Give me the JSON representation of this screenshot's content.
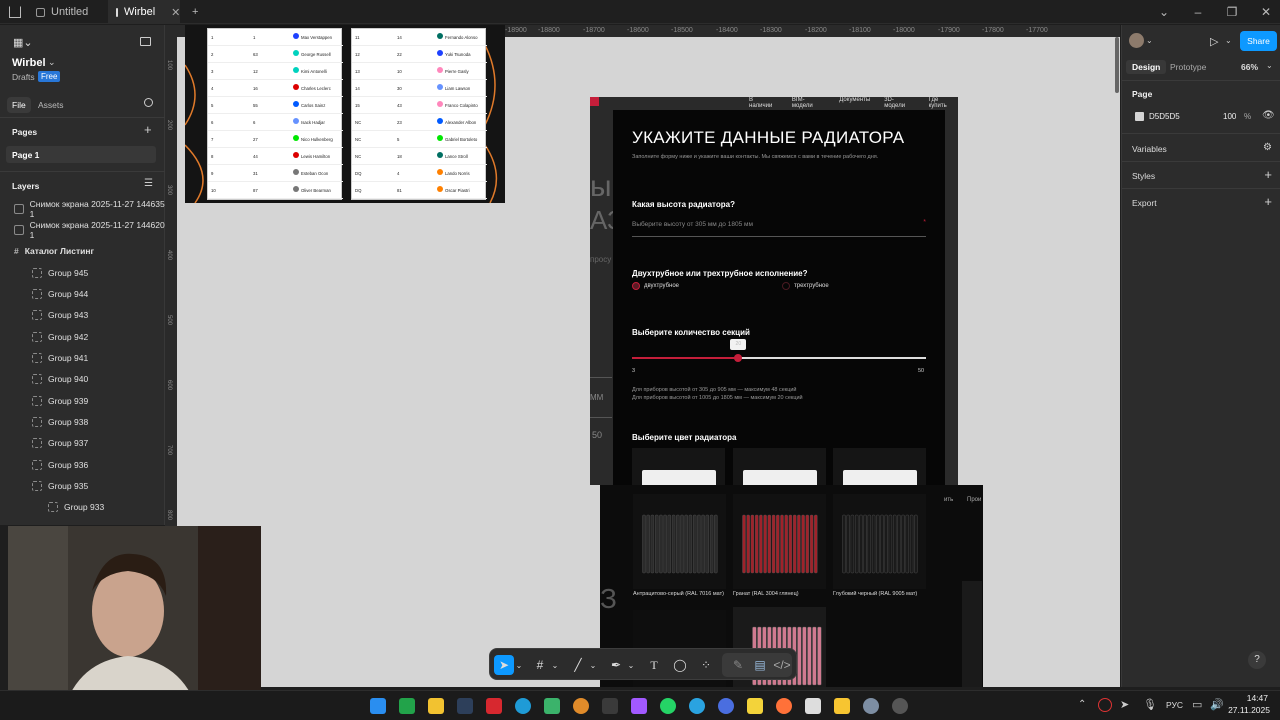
{
  "titlebar": {
    "tabs": [
      {
        "label": "Untitled"
      },
      {
        "label": "Wirbel"
      }
    ]
  },
  "file": {
    "name": "Wirbel",
    "location": "Drafts",
    "plan": "Free",
    "tab_file": "File",
    "tab_assets": "Assets"
  },
  "pages": {
    "title": "Pages",
    "items": [
      "Page 1"
    ]
  },
  "layers": {
    "title": "Layers",
    "items": [
      "Снимок экрана 2025-11-27 144635 1",
      "Снимок экрана 2025-11-27 144620 1",
      "Каталог Листинг",
      "Group 945",
      "Group 944",
      "Group 943",
      "Group 942",
      "Group 941",
      "Group 940",
      "Group 939",
      "Group 938",
      "Group 937",
      "Group 936",
      "Group 935",
      "Group 933"
    ]
  },
  "ruler": {
    "top": [
      "-18900",
      "-18800",
      "-18700",
      "-18600",
      "-18500",
      "-18400",
      "-18300",
      "-18200",
      "-18100",
      "-18000",
      "-17900",
      "-17800",
      "-17700"
    ],
    "left": [
      "100",
      "200",
      "300",
      "400",
      "500",
      "600",
      "700",
      "800",
      "900",
      "1000"
    ]
  },
  "right": {
    "tab_design": "Design",
    "tab_prototype": "Prototype",
    "zoom": "66%",
    "share": "Share",
    "page_label": "Page",
    "page_color": "D5D5D5",
    "page_opacity": "100",
    "percent": "%",
    "variables": "Variables",
    "styles": "Styles",
    "export": "Export",
    "colors": {
      "accent": "#0d99ff",
      "canvas": "#D5D5D5"
    }
  },
  "race_table": {
    "left": [
      {
        "pos": "1",
        "num": "1",
        "driver": "Max Verstappen",
        "color": "#1e41ff"
      },
      {
        "pos": "2",
        "num": "63",
        "driver": "George Russell",
        "color": "#00d2be"
      },
      {
        "pos": "3",
        "num": "12",
        "driver": "Kimi Antonelli",
        "color": "#00d2be"
      },
      {
        "pos": "4",
        "num": "16",
        "driver": "Charles Leclerc",
        "color": "#dc0000"
      },
      {
        "pos": "5",
        "num": "55",
        "driver": "Carlos Sainz",
        "color": "#005aff"
      },
      {
        "pos": "6",
        "num": "6",
        "driver": "Isack Hadjar",
        "color": "#6692ff"
      },
      {
        "pos": "7",
        "num": "27",
        "driver": "Nico Hulkenberg",
        "color": "#00e701"
      },
      {
        "pos": "8",
        "num": "44",
        "driver": "Lewis Hamilton",
        "color": "#dc0000"
      },
      {
        "pos": "9",
        "num": "31",
        "driver": "Esteban Ocon",
        "color": "#777777"
      },
      {
        "pos": "10",
        "num": "87",
        "driver": "Oliver Bearman",
        "color": "#777777"
      }
    ],
    "right": [
      {
        "pos": "11",
        "num": "14",
        "driver": "Fernando Alonso",
        "color": "#006f62"
      },
      {
        "pos": "12",
        "num": "22",
        "driver": "Yuki Tsunoda",
        "color": "#1e41ff"
      },
      {
        "pos": "13",
        "num": "10",
        "driver": "Pierre Gasly",
        "color": "#ff87bc"
      },
      {
        "pos": "14",
        "num": "30",
        "driver": "Liam Lawson",
        "color": "#6692ff"
      },
      {
        "pos": "15",
        "num": "43",
        "driver": "Franco Colapinto",
        "color": "#ff87bc"
      },
      {
        "pos": "NC",
        "num": "23",
        "driver": "Alexander Albon",
        "color": "#005aff"
      },
      {
        "pos": "NC",
        "num": "5",
        "driver": "Gabriel Bortoleto",
        "color": "#00e701"
      },
      {
        "pos": "NC",
        "num": "18",
        "driver": "Lance Stroll",
        "color": "#006f62"
      },
      {
        "pos": "DQ",
        "num": "4",
        "driver": "Lando Norris",
        "color": "#ff8000"
      },
      {
        "pos": "DQ",
        "num": "81",
        "driver": "Oscar Piastri",
        "color": "#ff8000"
      }
    ]
  },
  "form": {
    "nav": [
      "В наличии",
      "BIM-модели",
      "Документы",
      "3D-модели",
      "Где купить"
    ],
    "title": "УКАЖИТЕ ДАННЫЕ РАДИАТОРА",
    "subtitle": "Заполните форму ниже и укажите ваши контакты. Мы свяжемся с вами в течение рабочего дня.",
    "q_height": "Какая высота радиатора?",
    "height_placeholder": "Выберите высоту от 305 мм до 1805 мм",
    "q_type": "Двухтрубное или трехтрубное исполнение?",
    "opt_two": "двухтрубное",
    "opt_three": "трехтрубное",
    "q_sections": "Выберите количество секций",
    "slider_value": "20",
    "slider_min": "3",
    "slider_max": "50",
    "note1": "Для приборов высотой от 305 до 905 мм — максимум 48 секций",
    "note2": "Для приборов высотой от 1005 до 1805 мм — максимум 20 секций",
    "q_color": "Выберите цвет радиатора",
    "colors": [
      {
        "label": "Антрацитово-серый (RAL 7016 мат)",
        "hex": "#2b2b2b"
      },
      {
        "label": "Гранат (RAL 3004 глянец)",
        "hex": "#a0222a"
      },
      {
        "label": "Глубокий черный (RAL 9005 мат)",
        "hex": "#1a1a1a"
      }
    ],
    "side_fragments": {
      "a": "ы",
      "b": "АЗ",
      "c": "просу",
      "d": "ММ",
      "e": "50",
      "f": "ить",
      "g": "Прои"
    }
  },
  "system": {
    "lang": "РУС",
    "time": "14:47",
    "date": "27.11.2025"
  }
}
